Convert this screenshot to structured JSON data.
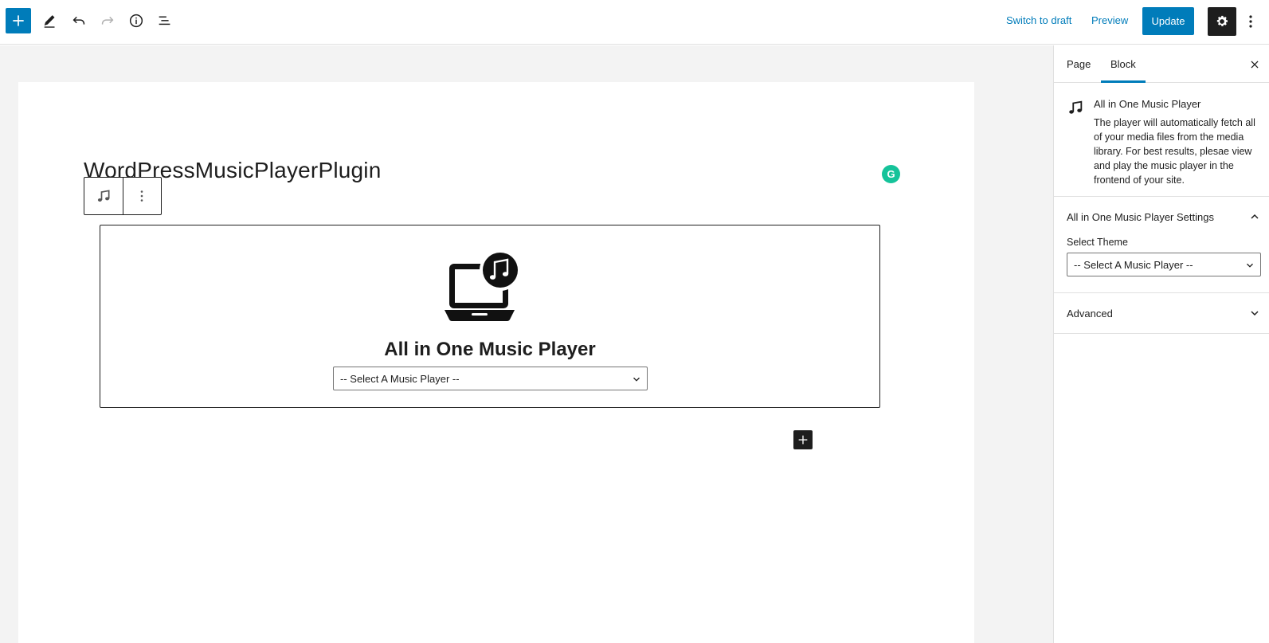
{
  "toolbar": {
    "add_icon": "plus-icon",
    "tools_icon": "pencil-icon",
    "undo_icon": "undo-icon",
    "redo_icon": "redo-icon",
    "info_icon": "info-icon",
    "list_icon": "list-view-icon",
    "switch_to_draft_label": "Switch to draft",
    "preview_label": "Preview",
    "update_label": "Update",
    "settings_icon": "gear-icon",
    "more_icon": "vertical-ellipsis-icon",
    "colors": {
      "accent": "#007cba",
      "dark": "#1e1e1e"
    }
  },
  "editor": {
    "post_title": "WordPressMusicPlayerPlugin",
    "grammarly_label": "G",
    "block": {
      "title": "All in One Music Player",
      "select_value": "-- Select A Music Player --"
    }
  },
  "sidebar": {
    "tabs": [
      {
        "label": "Page",
        "active": false
      },
      {
        "label": "Block",
        "active": true
      }
    ],
    "block_card": {
      "title": "All in One Music Player",
      "description": "The player will automatically fetch all of your media files from the media library. For best results, plesae view and play the music player in the frontend of your site."
    },
    "settings_panel": {
      "title": "All in One Music Player Settings",
      "field_label": "Select Theme",
      "select_value": "-- Select A Music Player --",
      "expanded": true
    },
    "advanced_panel": {
      "title": "Advanced",
      "expanded": false
    }
  }
}
